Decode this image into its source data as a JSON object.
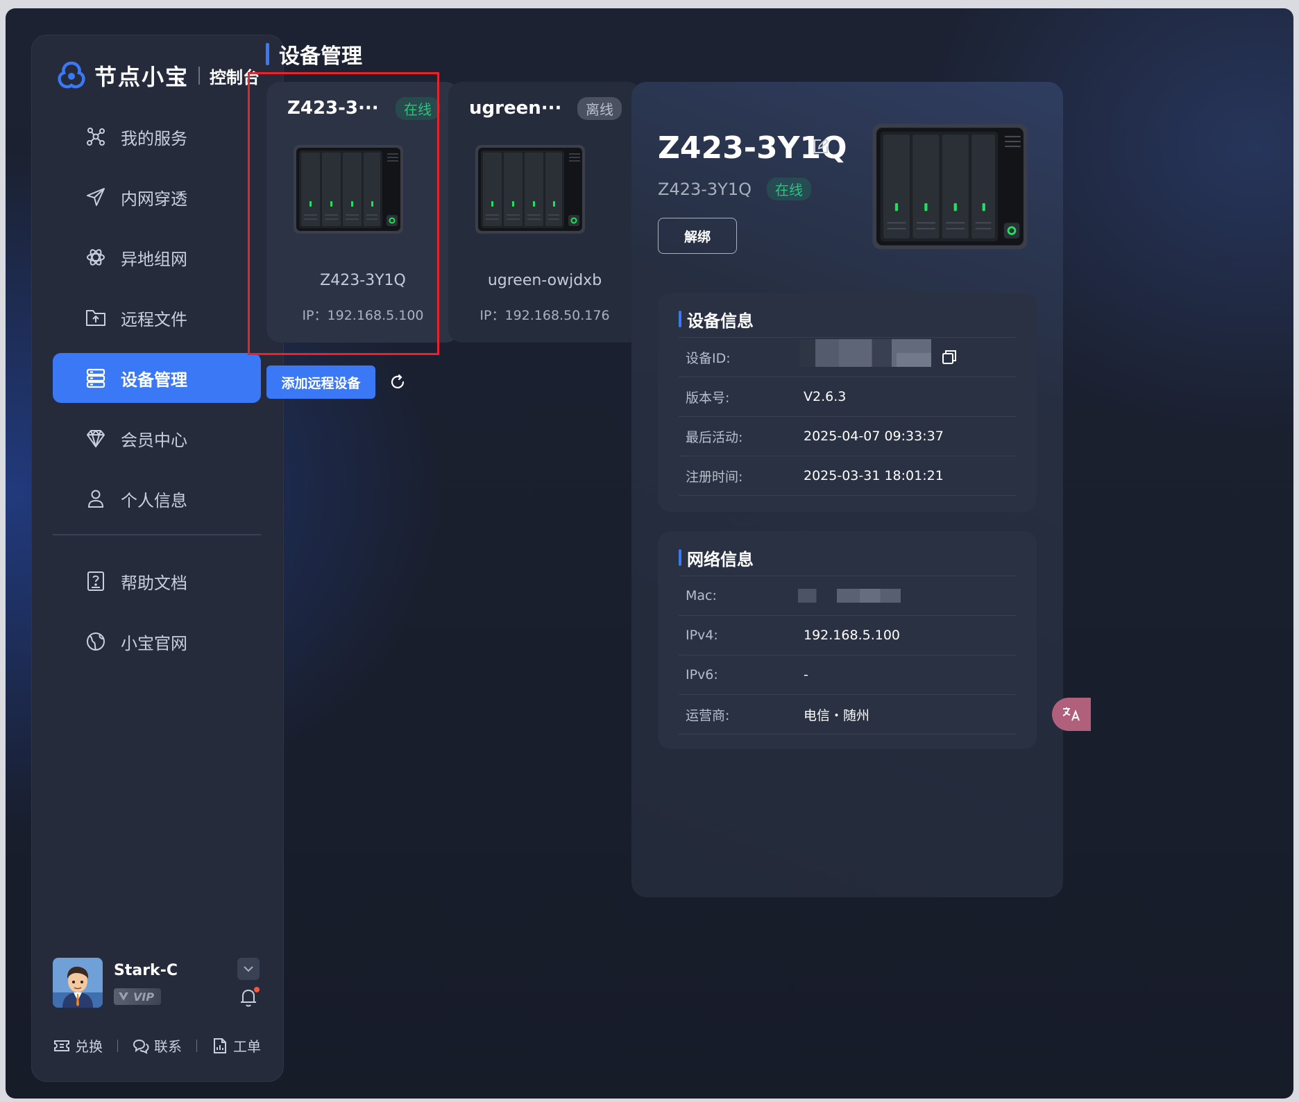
{
  "app": {
    "brand": "节点小宝",
    "brand_sub": "控制台"
  },
  "sidebar": {
    "items": [
      {
        "label": "我的服务",
        "icon": "network-nodes-icon"
      },
      {
        "label": "内网穿透",
        "icon": "paper-plane-icon"
      },
      {
        "label": "异地组网",
        "icon": "atom-icon"
      },
      {
        "label": "远程文件",
        "icon": "folder-upload-icon"
      },
      {
        "label": "设备管理",
        "icon": "server-stack-icon",
        "active": true
      },
      {
        "label": "会员中心",
        "icon": "diamond-icon"
      },
      {
        "label": "个人信息",
        "icon": "user-icon"
      },
      {
        "label": "帮助文档",
        "icon": "help-doc-icon"
      },
      {
        "label": "小宝官网",
        "icon": "globe-icon"
      }
    ],
    "user": {
      "name": "Stark-C",
      "vip": "VIP"
    },
    "footer": {
      "redeem": "兑换",
      "contact": "联系",
      "ticket": "工单"
    }
  },
  "main": {
    "title": "设备管理",
    "devices": [
      {
        "short_name": "Z423-3···",
        "status": "在线",
        "name": "Z423-3Y1Q",
        "ip": "IP：192.168.5.100"
      },
      {
        "short_name": "ugreen···",
        "status": "离线",
        "name": "ugreen-owjdxb",
        "ip": "IP：192.168.50.176"
      }
    ],
    "add_button": "添加远程设备"
  },
  "detail": {
    "name": "Z423-3Y1Q",
    "sub_name": "Z423-3Y1Q",
    "status": "在线",
    "unbind": "解绑",
    "device_info": {
      "title": "设备信息",
      "rows": [
        {
          "k": "设备ID:",
          "v": ""
        },
        {
          "k": "版本号:",
          "v": "V2.6.3"
        },
        {
          "k": "最后活动:",
          "v": "2025-04-07 09:33:37"
        },
        {
          "k": "注册时间:",
          "v": "2025-03-31 18:01:21"
        }
      ]
    },
    "network_info": {
      "title": "网络信息",
      "rows": [
        {
          "k": "Mac:",
          "v": ""
        },
        {
          "k": "IPv4:",
          "v": "192.168.5.100"
        },
        {
          "k": "IPv6:",
          "v": "-"
        },
        {
          "k": "运营商:",
          "v": "电信・随州"
        }
      ]
    }
  },
  "colors": {
    "accent": "#3b78f5",
    "online": "#2ec27e",
    "highlight": "#e8232c"
  }
}
